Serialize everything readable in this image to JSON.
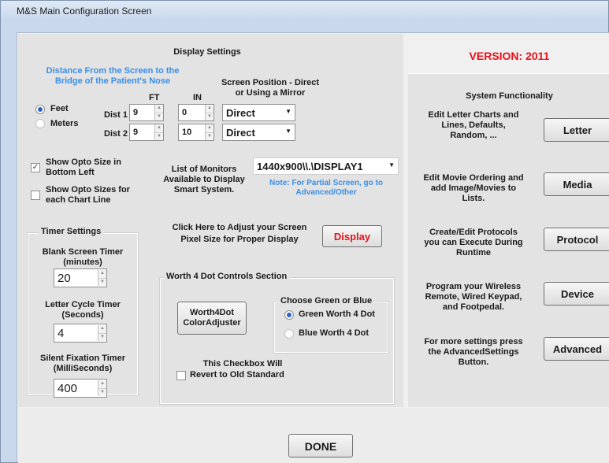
{
  "window": {
    "title": "M&S Main Configuration Screen"
  },
  "display_settings": {
    "heading": "Display Settings",
    "distance_note_line1": "Distance From the Screen to the",
    "distance_note_line2": "Bridge of the Patient's Nose",
    "screen_position_line1": "Screen Position - Direct",
    "screen_position_line2": "or Using a Mirror",
    "col_ft": "FT",
    "col_in": "IN",
    "units": [
      {
        "label": "Feet",
        "selected": true
      },
      {
        "label": "Meters",
        "selected": false
      }
    ],
    "dist1": {
      "label": "Dist 1",
      "ft": "9",
      "in": "0",
      "position": "Direct"
    },
    "dist2": {
      "label": "Dist 2",
      "ft": "9",
      "in": "10",
      "position": "Direct"
    },
    "show_opto_size": {
      "line1": "Show Opto Size in",
      "line2": "Bottom Left",
      "checked": true
    },
    "show_opto_sizes_chart": {
      "line1": "Show Opto Sizes for",
      "line2": "each Chart Line",
      "checked": false
    },
    "monitors_label_line1": "List of Monitors",
    "monitors_label_line2": "Available to Display",
    "monitors_label_line3": "Smart System.",
    "monitor_selected": "1440x900\\\\.\\DISPLAY1",
    "monitor_note_line1": "Note: For Partial Screen, go to",
    "monitor_note_line2": "Advanced/Other",
    "pixel_label_line1": "Click Here to Adjust your Screen",
    "pixel_label_line2": "Pixel Size for Proper Display",
    "display_button": "Display"
  },
  "timer_settings": {
    "heading": "Timer Settings",
    "blank_line1": "Blank Screen Timer",
    "blank_line2": "(minutes)",
    "blank_value": "20",
    "letter_line1": "Letter Cycle Timer",
    "letter_line2": "(Seconds)",
    "letter_value": "4",
    "fixation_line1": "Silent Fixation Timer",
    "fixation_line2": "(MilliSeconds)",
    "fixation_value": "400"
  },
  "worth4dot": {
    "heading": "Worth 4 Dot Controls Section",
    "adjuster_line1": "Worth4Dot",
    "adjuster_line2": "ColorAdjuster",
    "choose_heading": "Choose Green or Blue",
    "options": [
      {
        "label": "Green Worth 4 Dot",
        "selected": true
      },
      {
        "label": "Blue Worth 4 Dot",
        "selected": false
      }
    ],
    "revert_line1": "This Checkbox Will",
    "revert_line2": "Revert to Old Standard",
    "revert_checked": false
  },
  "right_panel": {
    "version": "VERSION: 2011",
    "heading": "System Functionality",
    "items": [
      {
        "desc_line1": "Edit Letter Charts and",
        "desc_line2": "Lines, Defaults,",
        "desc_line3": "Random, ...",
        "button": "Letter"
      },
      {
        "desc_line1": "Edit Movie Ordering and",
        "desc_line2": "add Image/Movies to",
        "desc_line3": "Lists.",
        "button": "Media"
      },
      {
        "desc_line1": "Create/Edit Protocols",
        "desc_line2": "you can Execute During",
        "desc_line3": "Runtime",
        "button": "Protocol"
      },
      {
        "desc_line1": "Program your Wireless",
        "desc_line2": "Remote, Wired Keypad,",
        "desc_line3": "and Footpedal.",
        "button": "Device"
      },
      {
        "desc_line1": "For more settings press",
        "desc_line2": "the AdvancedSettings",
        "desc_line3": "Button.",
        "button": "Advanced"
      }
    ]
  },
  "footer": {
    "done_button": "DONE"
  },
  "colors": {
    "version_red": "#e8101a",
    "note_blue": "#3a8ee6",
    "display_red": "#e8101a",
    "window_frame": "#c9d8ea"
  }
}
